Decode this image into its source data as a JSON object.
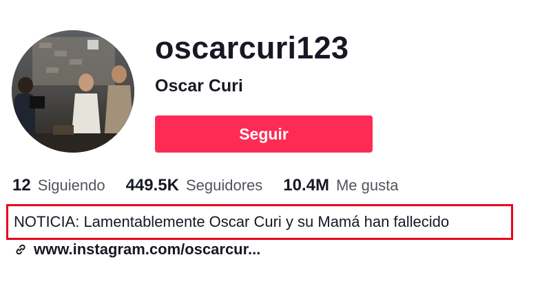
{
  "profile": {
    "username": "oscarcuri123",
    "display_name": "Oscar Curi",
    "follow_label": "Seguir",
    "avatar_icon": "profile-photo",
    "bio": "NOTICIA: Lamentablemente Oscar Curi y su Mamá han fallecido",
    "link": "www.instagram.com/oscarcur...",
    "link_icon": "link-icon"
  },
  "stats": [
    {
      "number": "12",
      "label": "Siguiendo"
    },
    {
      "number": "449.5K",
      "label": "Seguidores"
    },
    {
      "number": "10.4M",
      "label": "Me gusta"
    }
  ],
  "colors": {
    "follow_button": "#fe2c55",
    "highlight_border": "#e8001c",
    "text": "#161823"
  }
}
